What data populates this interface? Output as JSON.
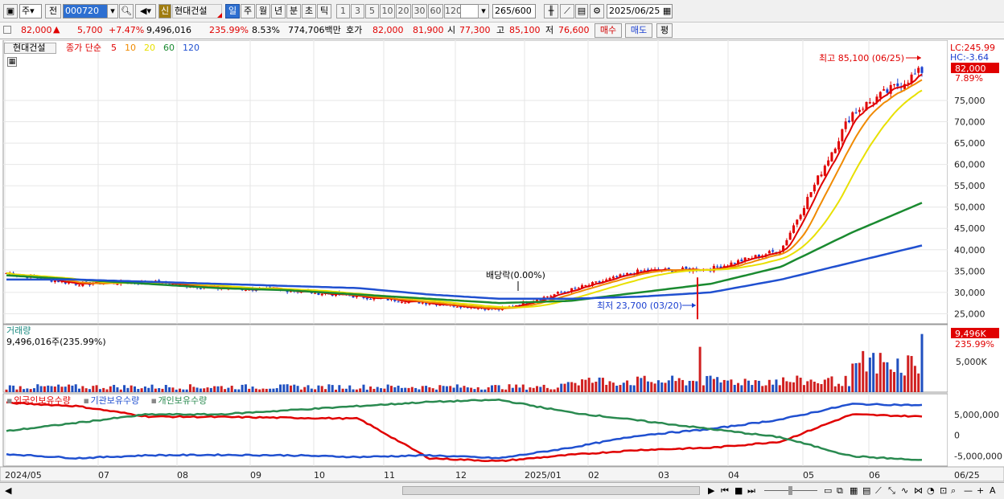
{
  "toolbar": {
    "type_select": "주",
    "prev_label": "전",
    "code_input": "000720",
    "credit_badge": "신",
    "stock_name": "현대건설",
    "period_buttons": [
      "일",
      "주",
      "월",
      "년",
      "분",
      "초",
      "틱"
    ],
    "selected_period": "일",
    "interval_buttons": [
      "1",
      "3",
      "5",
      "10",
      "20",
      "30",
      "60",
      "120"
    ],
    "count_value": "265",
    "count_total": "/600",
    "date_value": "2025/06/25"
  },
  "quote": {
    "price": "82,000",
    "change": "5,700",
    "change_pct": "+7.47%",
    "volume": "9,496,016",
    "volume_ratio": "235.99%",
    "turnover": "8.53%",
    "amount": "774,706백만",
    "hoga_label": "호가",
    "ask": "82,000",
    "bid": "81,900",
    "open_label": "시",
    "open": "77,300",
    "high_label": "고",
    "high": "85,100",
    "low_label": "저",
    "low": "76,600",
    "buy_button": "매수",
    "sell_button": "매도",
    "eval_button": "평"
  },
  "price_panel": {
    "legend_name": "현대건설",
    "legend_ma_prefix": "종가 단순",
    "legend_ma": [
      {
        "label": "5",
        "color": "#e00000"
      },
      {
        "label": "10",
        "color": "#f08a00"
      },
      {
        "label": "20",
        "color": "#e8e000"
      },
      {
        "label": "60",
        "color": "#1a8a30"
      },
      {
        "label": "120",
        "color": "#2050d0"
      }
    ],
    "lc": "LC:245.99",
    "hc": "HC:-3.64",
    "last_price_tag": "82,000",
    "last_pct_tag": "7.89%",
    "high_annotation": "최고 85,100 (06/25)",
    "low_annotation": "최저 23,700 (03/20)",
    "dividend_annotation": "배당락(0.00%)",
    "y_ticks": [
      "75,000",
      "70,000",
      "65,000",
      "60,000",
      "55,000",
      "50,000",
      "45,000",
      "40,000",
      "35,000",
      "30,000",
      "25,000"
    ]
  },
  "volume_panel": {
    "title": "거래량",
    "value": "9,496,016주(235.99%)",
    "tag": "9,496K",
    "tag_pct": "235.99%",
    "y_ticks": [
      "5,000K"
    ]
  },
  "holder_panel": {
    "legend": [
      {
        "label": "외국인보유수량",
        "color": "#e00000"
      },
      {
        "label": "기관보유수량",
        "color": "#2050d0"
      },
      {
        "label": "개인보유수량",
        "color": "#2a8a50"
      }
    ],
    "y_ticks": [
      "5,000,000",
      "0",
      "-5,000,000"
    ]
  },
  "x_axis": [
    "2024/05",
    "07",
    "08",
    "09",
    "10",
    "11",
    "12",
    "2025/01",
    "02",
    "03",
    "04",
    "05",
    "06",
    "06/25"
  ],
  "chart_data": {
    "type": "line",
    "title": "",
    "x": [
      "2024/05",
      "07",
      "08",
      "09",
      "10",
      "11",
      "12",
      "2025/01",
      "02",
      "03",
      "04",
      "05",
      "06",
      "06/25"
    ],
    "series": [
      {
        "name": "현대건설",
        "values": [
          34500,
          32000,
          32500,
          31000,
          30500,
          29000,
          27500,
          26000,
          30500,
          35000,
          35500,
          40000,
          72000,
          82000
        ]
      },
      {
        "name": "60",
        "values": [
          34000,
          33000,
          32000,
          31000,
          30500,
          29500,
          28500,
          27500,
          28000,
          30000,
          32000,
          36000,
          44000,
          51000
        ]
      },
      {
        "name": "120",
        "values": [
          33000,
          33000,
          32500,
          32000,
          31500,
          31000,
          29500,
          28500,
          28500,
          29000,
          30000,
          33000,
          37000,
          41000
        ]
      },
      {
        "name": "외국인보유수량",
        "values": [
          7800000,
          7000000,
          4500000,
          4400000,
          4200000,
          4000000,
          -5500000,
          -6200000,
          -4700000,
          -3500000,
          -3000000,
          -1500000,
          5000000,
          4500000
        ]
      },
      {
        "name": "기관보유수량",
        "values": [
          -4500000,
          -5500000,
          -4800000,
          -4700000,
          -4800000,
          -5200000,
          -4800000,
          -5500000,
          -3000000,
          0,
          1500000,
          3800000,
          7500000,
          7200000
        ]
      },
      {
        "name": "개인보유수량",
        "values": [
          1000000,
          3000000,
          5000000,
          5000000,
          6000000,
          7000000,
          8000000,
          8500000,
          5500000,
          3500000,
          1500000,
          -500000,
          -5000000,
          -6000000
        ]
      }
    ],
    "ylim": [
      23000,
      88000
    ],
    "high": 85100,
    "low": 23700,
    "grid": true
  }
}
